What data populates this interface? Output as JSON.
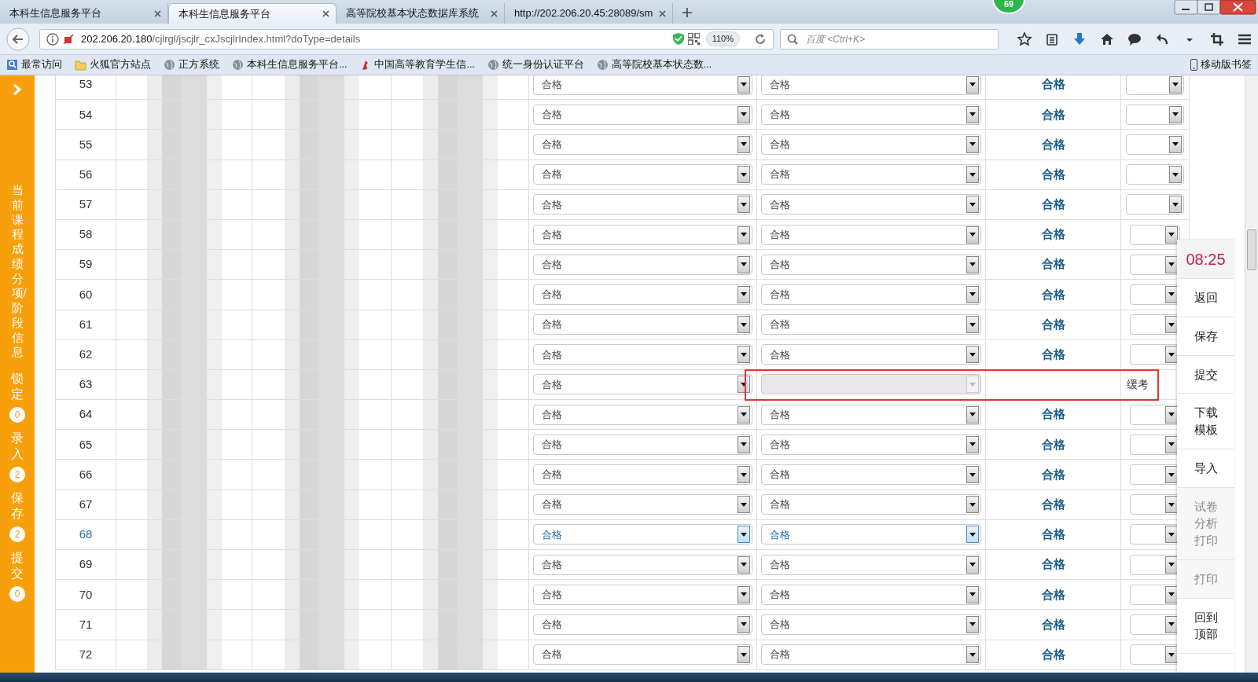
{
  "browser": {
    "tabs": [
      {
        "title": "本科生信息服务平台",
        "selected": false
      },
      {
        "title": "本科生信息服务平台",
        "selected": true
      },
      {
        "title": "高等院校基本状态数据库系统",
        "selected": false
      },
      {
        "title": "http://202.206.20.45:28089/sm",
        "selected": false
      }
    ],
    "notification_count": "69",
    "address_host": "202.206.20.180",
    "address_path": "/cjlrgl/jscjlr_cxJscjlrIndex.html?doType=details",
    "zoom": "110%",
    "search": {
      "placeholder": "百度 <Ctrl+K>"
    },
    "bookmarks": [
      {
        "label": "最常访问",
        "kind": "search"
      },
      {
        "label": "火狐官方站点",
        "kind": "folder"
      },
      {
        "label": "正方系统",
        "kind": "globe"
      },
      {
        "label": "本科生信息服务平台...",
        "kind": "globe"
      },
      {
        "label": "中国高等教育学生信...",
        "kind": "bird"
      },
      {
        "label": "统一身份认证平台",
        "kind": "globe"
      },
      {
        "label": "高等院校基本状态数...",
        "kind": "globe"
      }
    ],
    "mobile_bookmarks": "移动版书签"
  },
  "sidebar": {
    "title": "当前课程成绩分项/阶段信息",
    "counters": [
      {
        "label": "锁定",
        "count": "0"
      },
      {
        "label": "录入",
        "count": "2"
      },
      {
        "label": "保存",
        "count": "2"
      },
      {
        "label": "提交",
        "count": "0"
      }
    ]
  },
  "rows": [
    {
      "number": "53",
      "kind": "graded",
      "grade_1": "合格",
      "grade_2": "合格",
      "result": "合格",
      "highlighted": false,
      "marked": false
    },
    {
      "number": "54",
      "kind": "graded",
      "grade_1": "合格",
      "grade_2": "合格",
      "result": "合格",
      "highlighted": false,
      "marked": false
    },
    {
      "number": "55",
      "kind": "graded",
      "grade_1": "合格",
      "grade_2": "合格",
      "result": "合格",
      "highlighted": false,
      "marked": false
    },
    {
      "number": "56",
      "kind": "graded",
      "grade_1": "合格",
      "grade_2": "合格",
      "result": "合格",
      "highlighted": false,
      "marked": false
    },
    {
      "number": "57",
      "kind": "graded",
      "grade_1": "合格",
      "grade_2": "合格",
      "result": "合格",
      "highlighted": false,
      "marked": false
    },
    {
      "number": "58",
      "kind": "graded",
      "grade_1": "合格",
      "grade_2": "合格",
      "result": "合格",
      "highlighted": false,
      "marked": false
    },
    {
      "number": "59",
      "kind": "graded",
      "grade_1": "合格",
      "grade_2": "合格",
      "result": "合格",
      "highlighted": false,
      "marked": false
    },
    {
      "number": "60",
      "kind": "graded",
      "grade_1": "合格",
      "grade_2": "合格",
      "result": "合格",
      "highlighted": false,
      "marked": false
    },
    {
      "number": "61",
      "kind": "graded",
      "grade_1": "合格",
      "grade_2": "合格",
      "result": "合格",
      "highlighted": false,
      "marked": false
    },
    {
      "number": "62",
      "kind": "graded",
      "grade_1": "合格",
      "grade_2": "合格",
      "result": "合格",
      "highlighted": false,
      "marked": false
    },
    {
      "number": "63",
      "kind": "deferred",
      "grade_1": "合格",
      "note": "缓考",
      "highlighted": false,
      "marked": true
    },
    {
      "number": "64",
      "kind": "graded",
      "grade_1": "合格",
      "grade_2": "合格",
      "result": "合格",
      "highlighted": false,
      "marked": false
    },
    {
      "number": "65",
      "kind": "graded",
      "grade_1": "合格",
      "grade_2": "合格",
      "result": "合格",
      "highlighted": false,
      "marked": false
    },
    {
      "number": "66",
      "kind": "graded",
      "grade_1": "合格",
      "grade_2": "合格",
      "result": "合格",
      "highlighted": false,
      "marked": false
    },
    {
      "number": "67",
      "kind": "graded",
      "grade_1": "合格",
      "grade_2": "合格",
      "result": "合格",
      "highlighted": false,
      "marked": false
    },
    {
      "number": "68",
      "kind": "graded",
      "grade_1": "合格",
      "grade_2": "合格",
      "result": "合格",
      "highlighted": true,
      "marked": false
    },
    {
      "number": "69",
      "kind": "graded",
      "grade_1": "合格",
      "grade_2": "合格",
      "result": "合格",
      "highlighted": false,
      "marked": false
    },
    {
      "number": "70",
      "kind": "graded",
      "grade_1": "合格",
      "grade_2": "合格",
      "result": "合格",
      "highlighted": false,
      "marked": false
    },
    {
      "number": "71",
      "kind": "graded",
      "grade_1": "合格",
      "grade_2": "合格",
      "result": "合格",
      "highlighted": false,
      "marked": false
    },
    {
      "number": "72",
      "kind": "graded",
      "grade_1": "合格",
      "grade_2": "合格",
      "result": "合格",
      "highlighted": false,
      "marked": false
    }
  ],
  "timer": "08:25",
  "actions": [
    {
      "label": "返回",
      "disabled": false
    },
    {
      "label": "保存",
      "disabled": false
    },
    {
      "label": "提交",
      "disabled": false
    },
    {
      "label": "下载模板",
      "disabled": false
    },
    {
      "label": "导入",
      "disabled": false
    },
    {
      "label": "试卷分析打印",
      "disabled": true
    },
    {
      "label": "打印",
      "disabled": true
    },
    {
      "label": "回到顶部",
      "disabled": false
    }
  ]
}
